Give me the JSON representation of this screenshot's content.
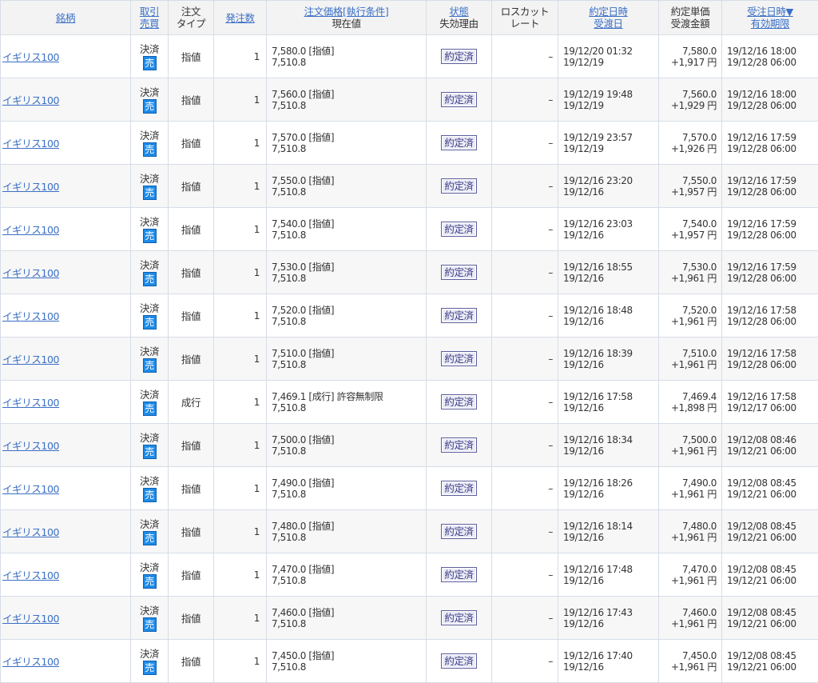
{
  "header": {
    "name": "銘柄",
    "side1": "取引",
    "side2": "売買",
    "type1": "注文",
    "type2": "タイプ",
    "qty": "発注数",
    "price1": "注文価格[執行条件]",
    "price2": "現在値",
    "state1": "状態",
    "state2": "失効理由",
    "loss1": "ロスカット",
    "loss2": "レート",
    "date1": "約定日時",
    "date2": "受渡日",
    "amt1": "約定単価",
    "amt2": "受渡金額",
    "recv1": "受注日時▼",
    "recv2": "有効期限"
  },
  "rows": [
    {
      "name": "イギリス100",
      "trade": "決済",
      "side": "売",
      "type": "指値",
      "qty": "1",
      "price": "7,580.0 [指値]",
      "current": "7,510.8",
      "state": "約定済",
      "loss": "–",
      "exec_date": "19/12/20 01:32",
      "settle_date": "19/12/19",
      "unit_price": "7,580.0",
      "amount": "+1,917 円",
      "recv_date": "19/12/16 18:00",
      "expiry": "19/12/28 06:00"
    },
    {
      "name": "イギリス100",
      "trade": "決済",
      "side": "売",
      "type": "指値",
      "qty": "1",
      "price": "7,560.0 [指値]",
      "current": "7,510.8",
      "state": "約定済",
      "loss": "–",
      "exec_date": "19/12/19 19:48",
      "settle_date": "19/12/19",
      "unit_price": "7,560.0",
      "amount": "+1,929 円",
      "recv_date": "19/12/16 18:00",
      "expiry": "19/12/28 06:00"
    },
    {
      "name": "イギリス100",
      "trade": "決済",
      "side": "売",
      "type": "指値",
      "qty": "1",
      "price": "7,570.0 [指値]",
      "current": "7,510.8",
      "state": "約定済",
      "loss": "–",
      "exec_date": "19/12/19 23:57",
      "settle_date": "19/12/19",
      "unit_price": "7,570.0",
      "amount": "+1,926 円",
      "recv_date": "19/12/16 17:59",
      "expiry": "19/12/28 06:00"
    },
    {
      "name": "イギリス100",
      "trade": "決済",
      "side": "売",
      "type": "指値",
      "qty": "1",
      "price": "7,550.0 [指値]",
      "current": "7,510.8",
      "state": "約定済",
      "loss": "–",
      "exec_date": "19/12/16 23:20",
      "settle_date": "19/12/16",
      "unit_price": "7,550.0",
      "amount": "+1,957 円",
      "recv_date": "19/12/16 17:59",
      "expiry": "19/12/28 06:00"
    },
    {
      "name": "イギリス100",
      "trade": "決済",
      "side": "売",
      "type": "指値",
      "qty": "1",
      "price": "7,540.0 [指値]",
      "current": "7,510.8",
      "state": "約定済",
      "loss": "–",
      "exec_date": "19/12/16 23:03",
      "settle_date": "19/12/16",
      "unit_price": "7,540.0",
      "amount": "+1,957 円",
      "recv_date": "19/12/16 17:59",
      "expiry": "19/12/28 06:00"
    },
    {
      "name": "イギリス100",
      "trade": "決済",
      "side": "売",
      "type": "指値",
      "qty": "1",
      "price": "7,530.0 [指値]",
      "current": "7,510.8",
      "state": "約定済",
      "loss": "–",
      "exec_date": "19/12/16 18:55",
      "settle_date": "19/12/16",
      "unit_price": "7,530.0",
      "amount": "+1,961 円",
      "recv_date": "19/12/16 17:59",
      "expiry": "19/12/28 06:00"
    },
    {
      "name": "イギリス100",
      "trade": "決済",
      "side": "売",
      "type": "指値",
      "qty": "1",
      "price": "7,520.0 [指値]",
      "current": "7,510.8",
      "state": "約定済",
      "loss": "–",
      "exec_date": "19/12/16 18:48",
      "settle_date": "19/12/16",
      "unit_price": "7,520.0",
      "amount": "+1,961 円",
      "recv_date": "19/12/16 17:58",
      "expiry": "19/12/28 06:00"
    },
    {
      "name": "イギリス100",
      "trade": "決済",
      "side": "売",
      "type": "指値",
      "qty": "1",
      "price": "7,510.0 [指値]",
      "current": "7,510.8",
      "state": "約定済",
      "loss": "–",
      "exec_date": "19/12/16 18:39",
      "settle_date": "19/12/16",
      "unit_price": "7,510.0",
      "amount": "+1,961 円",
      "recv_date": "19/12/16 17:58",
      "expiry": "19/12/28 06:00"
    },
    {
      "name": "イギリス100",
      "trade": "決済",
      "side": "売",
      "type": "成行",
      "qty": "1",
      "price": "7,469.1 [成行] 許容無制限",
      "current": "7,510.8",
      "state": "約定済",
      "loss": "–",
      "exec_date": "19/12/16 17:58",
      "settle_date": "19/12/16",
      "unit_price": "7,469.4",
      "amount": "+1,898 円",
      "recv_date": "19/12/16 17:58",
      "expiry": "19/12/17 06:00"
    },
    {
      "name": "イギリス100",
      "trade": "決済",
      "side": "売",
      "type": "指値",
      "qty": "1",
      "price": "7,500.0 [指値]",
      "current": "7,510.8",
      "state": "約定済",
      "loss": "–",
      "exec_date": "19/12/16 18:34",
      "settle_date": "19/12/16",
      "unit_price": "7,500.0",
      "amount": "+1,961 円",
      "recv_date": "19/12/08 08:46",
      "expiry": "19/12/21 06:00"
    },
    {
      "name": "イギリス100",
      "trade": "決済",
      "side": "売",
      "type": "指値",
      "qty": "1",
      "price": "7,490.0 [指値]",
      "current": "7,510.8",
      "state": "約定済",
      "loss": "–",
      "exec_date": "19/12/16 18:26",
      "settle_date": "19/12/16",
      "unit_price": "7,490.0",
      "amount": "+1,961 円",
      "recv_date": "19/12/08 08:45",
      "expiry": "19/12/21 06:00"
    },
    {
      "name": "イギリス100",
      "trade": "決済",
      "side": "売",
      "type": "指値",
      "qty": "1",
      "price": "7,480.0 [指値]",
      "current": "7,510.8",
      "state": "約定済",
      "loss": "–",
      "exec_date": "19/12/16 18:14",
      "settle_date": "19/12/16",
      "unit_price": "7,480.0",
      "amount": "+1,961 円",
      "recv_date": "19/12/08 08:45",
      "expiry": "19/12/21 06:00"
    },
    {
      "name": "イギリス100",
      "trade": "決済",
      "side": "売",
      "type": "指値",
      "qty": "1",
      "price": "7,470.0 [指値]",
      "current": "7,510.8",
      "state": "約定済",
      "loss": "–",
      "exec_date": "19/12/16 17:48",
      "settle_date": "19/12/16",
      "unit_price": "7,470.0",
      "amount": "+1,961 円",
      "recv_date": "19/12/08 08:45",
      "expiry": "19/12/21 06:00"
    },
    {
      "name": "イギリス100",
      "trade": "決済",
      "side": "売",
      "type": "指値",
      "qty": "1",
      "price": "7,460.0 [指値]",
      "current": "7,510.8",
      "state": "約定済",
      "loss": "–",
      "exec_date": "19/12/16 17:43",
      "settle_date": "19/12/16",
      "unit_price": "7,460.0",
      "amount": "+1,961 円",
      "recv_date": "19/12/08 08:45",
      "expiry": "19/12/21 06:00"
    },
    {
      "name": "イギリス100",
      "trade": "決済",
      "side": "売",
      "type": "指値",
      "qty": "1",
      "price": "7,450.0 [指値]",
      "current": "7,510.8",
      "state": "約定済",
      "loss": "–",
      "exec_date": "19/12/16 17:40",
      "settle_date": "19/12/16",
      "unit_price": "7,450.0",
      "amount": "+1,961 円",
      "recv_date": "19/12/08 08:45",
      "expiry": "19/12/21 06:00"
    }
  ]
}
